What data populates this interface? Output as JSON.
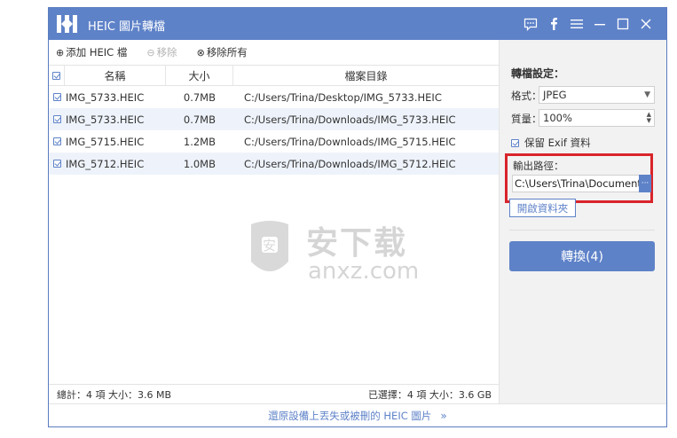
{
  "window": {
    "title": "HEIC 圖片轉檔"
  },
  "toolbar": {
    "add_label": "添加 HEIC 檔",
    "remove_label": "移除",
    "remove_all_label": "移除所有"
  },
  "table": {
    "headers": [
      "名稱",
      "大小",
      "檔案目錄"
    ],
    "rows": [
      {
        "name": "IMG_5733.HEIC",
        "size": "0.7MB",
        "path": "C:/Users/Trina/Desktop/IMG_5733.HEIC"
      },
      {
        "name": "IMG_5733.HEIC",
        "size": "0.7MB",
        "path": "C:/Users/Trina/Downloads/IMG_5733.HEIC"
      },
      {
        "name": "IMG_5715.HEIC",
        "size": "1.2MB",
        "path": "C:/Users/Trina/Downloads/IMG_5715.HEIC"
      },
      {
        "name": "IMG_5712.HEIC",
        "size": "1.0MB",
        "path": "C:/Users/Trina/Downloads/IMG_5712.HEIC"
      }
    ]
  },
  "status": {
    "total": "總計：4 項 大小：3.6 MB",
    "selected": "已選擇：4 項 大小：3.6 GB"
  },
  "watermark": {
    "text1": "安下载",
    "text2": "anxz.com",
    "badge": "安"
  },
  "settings": {
    "title": "轉檔設定：",
    "format_label": "格式：",
    "format_value": "JPEG",
    "quality_label": "質量：",
    "quality_value": "100%",
    "exif_label": "保留 Exif 資料",
    "output_label": "輸出路徑：",
    "output_value": "C:\\Users\\Trina\\Documents\\",
    "browse_label": "···",
    "open_folder_label": "開啟資料夾",
    "convert_label": "轉換(4)"
  },
  "footer": {
    "link_label": "還原設備上丟失或被刪的 HEIC 圖片"
  },
  "colors": {
    "accent": "#5e82c8",
    "highlight_border": "#d9242b"
  }
}
